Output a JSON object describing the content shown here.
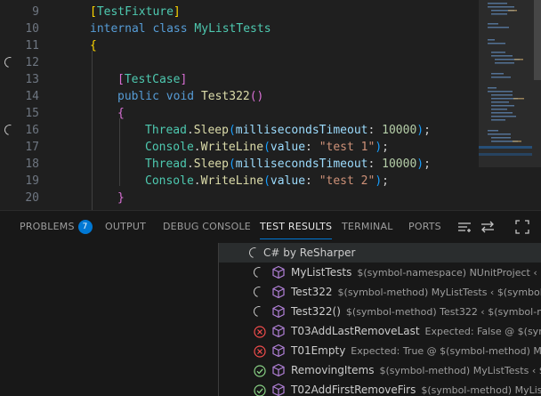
{
  "editor": {
    "lines": [
      {
        "num": "9",
        "loading": false
      },
      {
        "num": "10",
        "loading": false
      },
      {
        "num": "11",
        "loading": false
      },
      {
        "num": "12",
        "loading": true
      },
      {
        "num": "13",
        "loading": false
      },
      {
        "num": "14",
        "loading": false
      },
      {
        "num": "15",
        "loading": false
      },
      {
        "num": "16",
        "loading": true
      },
      {
        "num": "17",
        "loading": false
      },
      {
        "num": "18",
        "loading": false
      },
      {
        "num": "19",
        "loading": false
      },
      {
        "num": "20",
        "loading": false
      }
    ],
    "code": {
      "l9_attr": "TestFixture",
      "l10_kw1": "internal",
      "l10_kw2": "class",
      "l10_name": "MyListTests",
      "l13_attr": "TestCase",
      "l14_kw1": "public",
      "l14_kw2": "void",
      "l14_name": "Test322",
      "thread": "Thread",
      "sleep": "Sleep",
      "timeout_param": "millisecondsTimeout",
      "timeout_value": "10000",
      "console": "Console",
      "writeline": "WriteLine",
      "value_param": "value",
      "str1": "\"test 1\"",
      "str2": "\"test 2\""
    }
  },
  "panel": {
    "tabs": {
      "problems": "PROBLEMS",
      "problems_count": "7",
      "output": "OUTPUT",
      "debug_console": "DEBUG CONSOLE",
      "test_results": "TEST RESULTS",
      "terminal": "TERMINAL",
      "ports": "PORTS"
    },
    "active_tab": "TEST RESULTS",
    "icons": [
      "list-filter-icon",
      "swap-icon",
      "maximize-icon"
    ],
    "tree": {
      "root": {
        "label": "C# by ReSharper",
        "status": "running"
      },
      "rows": [
        {
          "name": "MyListTests",
          "desc": "$(symbol-namespace) NUnitProject ‹ $(",
          "status": "running"
        },
        {
          "name": "Test322",
          "desc": "$(symbol-method) MyListTests ‹ $(symbol-",
          "status": "running"
        },
        {
          "name": "Test322()",
          "desc": "$(symbol-method) Test322 ‹ $(symbol-me",
          "status": "running"
        },
        {
          "name": "T03AddLastRemoveLast",
          "desc": "Expected: False @ $(sym",
          "status": "failed"
        },
        {
          "name": "T01Empty",
          "desc": "Expected: True @ $(symbol-method) M",
          "status": "failed"
        },
        {
          "name": "RemovingItems",
          "desc": "$(symbol-method) MyListTests ‹ $(s",
          "status": "passed"
        },
        {
          "name": "T02AddFirstRemoveFirs",
          "desc": "$(symbol-method) MyList",
          "status": "passed"
        }
      ]
    },
    "colors": {
      "accent": "#0078d4",
      "failed": "#f14c4c",
      "passed": "#89d185",
      "cube": "#b180d7"
    }
  }
}
